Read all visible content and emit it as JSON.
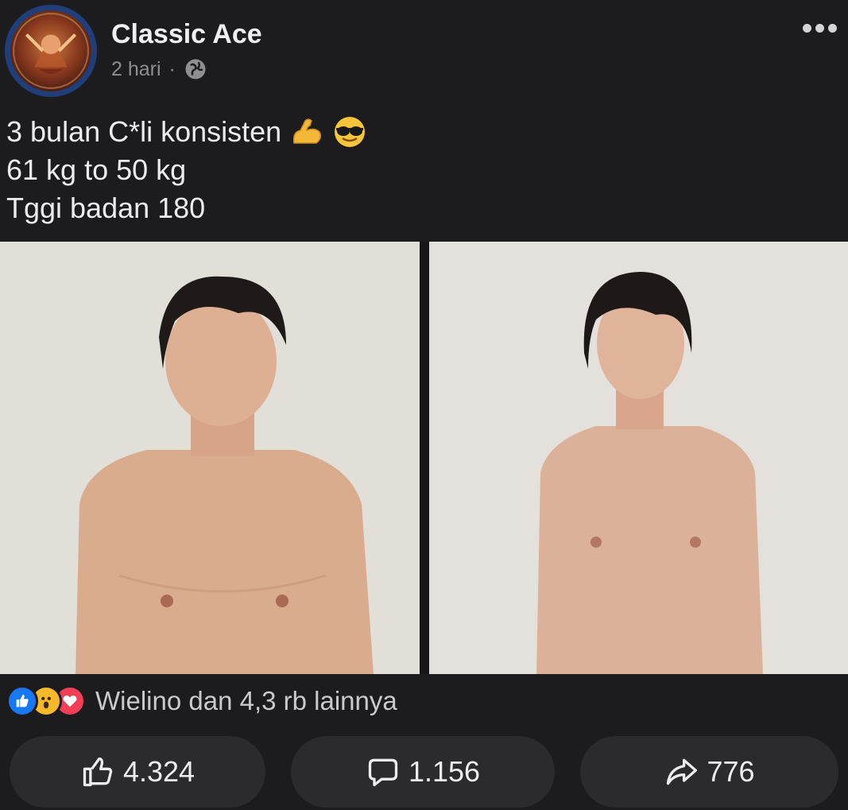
{
  "post": {
    "author": "Classic Ace",
    "time": "2 hari",
    "separator": "·",
    "caption_lines": [
      "3 bulan C*li konsisten",
      "61 kg to 50 kg",
      "Tggi badan 180"
    ]
  },
  "reactions": {
    "summary": "Wielino dan 4,3 rb lainnya",
    "icons": [
      "like-icon",
      "wow-icon",
      "love-icon"
    ]
  },
  "actions": {
    "like_count": "4.324",
    "comment_count": "1.156",
    "share_count": "776"
  },
  "colors": {
    "background": "#1c1c1f",
    "like_blue": "#1877f2",
    "love_red": "#f33e58",
    "wow_yellow": "#f7b928",
    "button_bg": "#2b2b2f"
  }
}
